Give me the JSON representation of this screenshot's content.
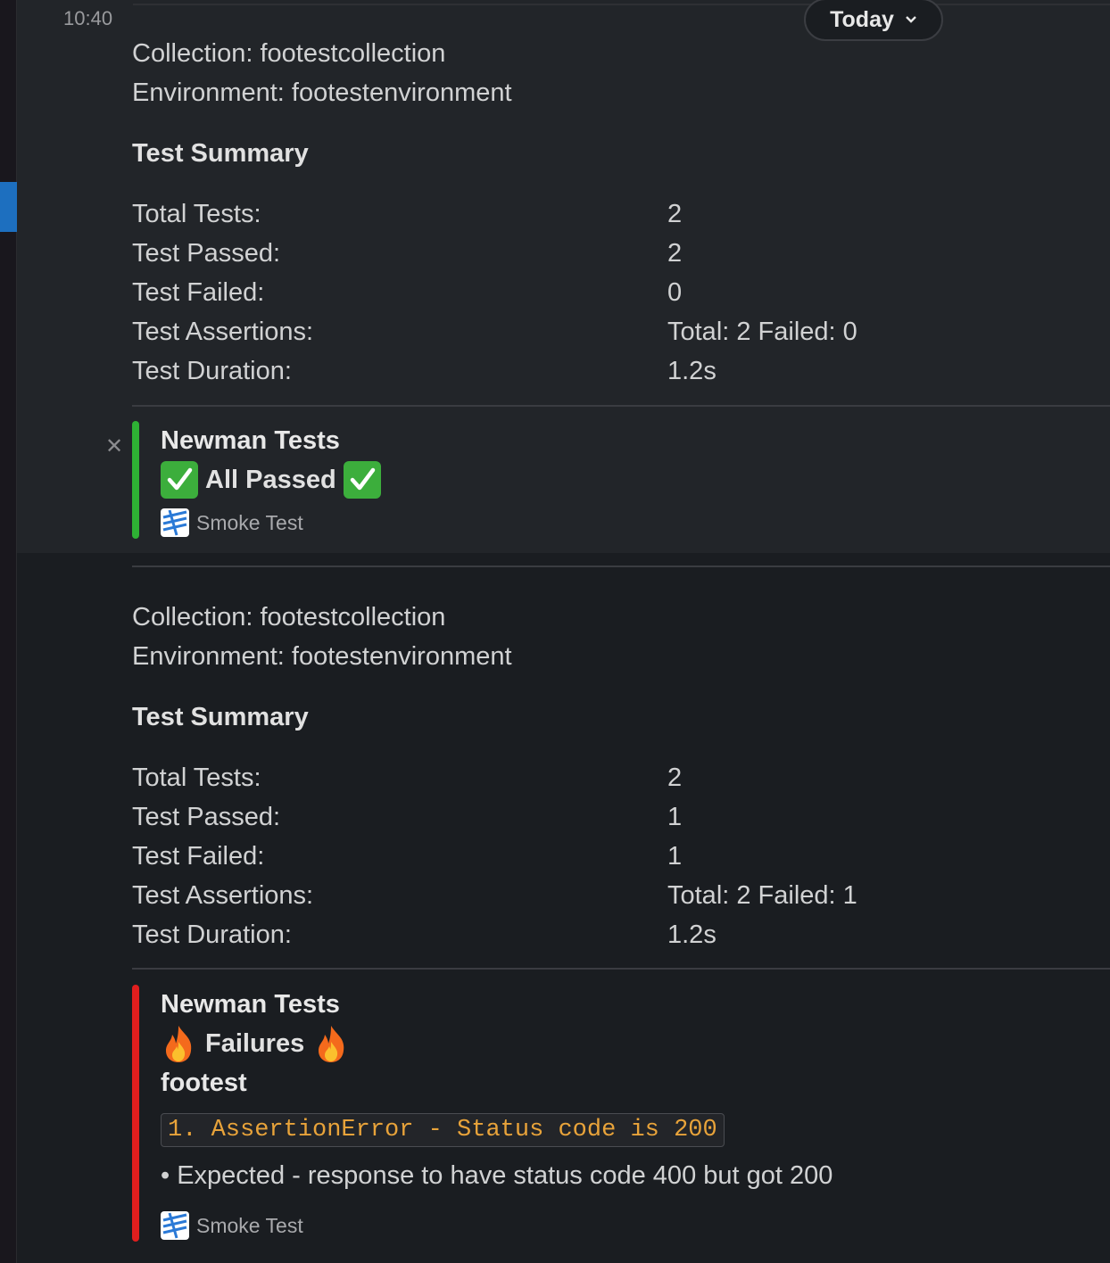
{
  "header": {
    "time": "10:40",
    "today_label": "Today"
  },
  "messages": [
    {
      "collection": "Collection: footestcollection",
      "environment": "Environment: footestenvironment",
      "summary_title": "Test Summary",
      "rows": [
        {
          "label": "Total Tests:",
          "value": "2"
        },
        {
          "label": "Test Passed:",
          "value": "2"
        },
        {
          "label": "Test Failed:",
          "value": "0"
        },
        {
          "label": "Test Assertions:",
          "value": "Total: 2  Failed: 0"
        },
        {
          "label": "Test Duration:",
          "value": "1.2s"
        }
      ],
      "attachment": {
        "title": "Newman Tests",
        "status": "All Passed",
        "footer": "Smoke Test",
        "bar_color": "#2eb134",
        "status_icon": "check-mark-icon"
      }
    },
    {
      "collection": "Collection: footestcollection",
      "environment": "Environment: footestenvironment",
      "summary_title": "Test Summary",
      "rows": [
        {
          "label": "Total Tests:",
          "value": "2"
        },
        {
          "label": "Test Passed:",
          "value": "1"
        },
        {
          "label": "Test Failed:",
          "value": "1"
        },
        {
          "label": "Test Assertions:",
          "value": "Total: 2  Failed: 1"
        },
        {
          "label": "Test Duration:",
          "value": "1.2s"
        }
      ],
      "attachment": {
        "title": "Newman Tests",
        "status": "Failures",
        "test_name": "footest",
        "error_code": "1. AssertionError - Status code is 200",
        "error_detail": "• Expected - response to have status code 400 but got 200",
        "footer": "Smoke Test",
        "bar_color": "#e01e1e",
        "status_icon": "fire-icon"
      }
    }
  ]
}
